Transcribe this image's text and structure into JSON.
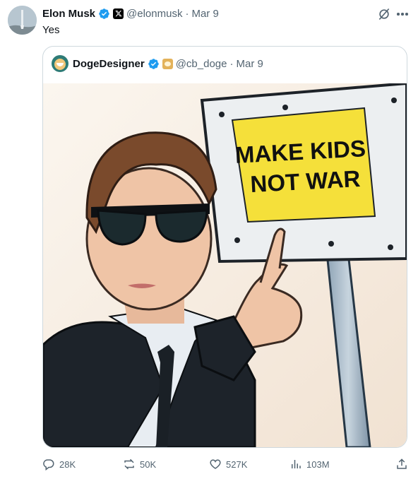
{
  "author": {
    "name": "Elon Musk",
    "handle": "@elonmusk",
    "date": "Mar 9",
    "verified_badge": "blue-verified-icon",
    "affiliate_badge": "x-logo-icon"
  },
  "tweet": {
    "text": "Yes"
  },
  "quote": {
    "name": "DogeDesigner",
    "handle": "@cb_doge",
    "date": "Mar 9",
    "sign_text_line1": "MAKE KIDS",
    "sign_text_line2": "NOT WAR"
  },
  "metrics": {
    "replies": "28K",
    "reposts": "50K",
    "likes": "527K",
    "views": "103M"
  },
  "colors": {
    "accent": "#1d9bf0",
    "muted": "#536471",
    "border": "#cfd9de",
    "sign_yellow": "#f5e03a"
  }
}
